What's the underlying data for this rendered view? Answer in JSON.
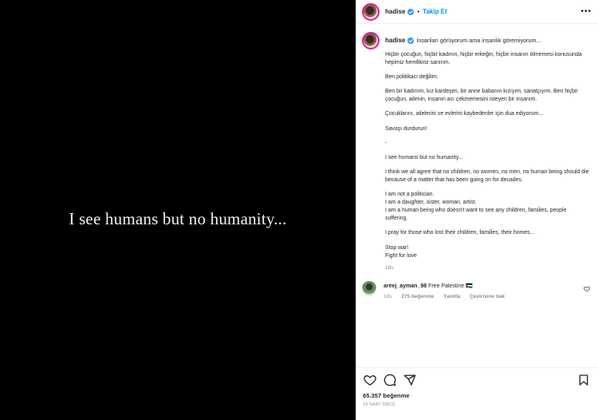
{
  "media": {
    "text": "I see humans but no humanity..."
  },
  "header": {
    "username": "hadise",
    "separator": "•",
    "follow_label": "Takip Et",
    "more_label": "•••"
  },
  "caption": {
    "username": "hadise",
    "first_line": "İnsanları görüyorum ama insanlık göremiyorum...",
    "paragraphs": [
      "Hiçbir çocuğun, hiçbir kadının, hiçbir erkeğin, hiçbir insanın ölmemesi konusunda hepimiz hemfikiriz sanırım.",
      "Ben politikacı değilim.",
      "Ben bir kadınım, kız kardeşim, bir anne babanın kızıyım, sanatçıyım. Ben hiçbir çocuğun, ailenin, insanın acı çekmemesini isteyen bir insanım.",
      "Çocuklarını, ailelerini ve evlerini kaybedenler için dua ediyorum...",
      "Savaşı durdurun!",
      "-",
      "I see humans but no humanity...",
      "I think we all agree that no children, no women, no men, no human being should die because of a matter that has been going on for decades.",
      "I am not a politician.\nI am a daughter, sister, woman, artist.\nI am a human being who doesn't want to see any children, families, people suffering.",
      "I pray for those who lost their children, families, their homes...",
      "Stop war!\nFight for love"
    ],
    "time": "18s"
  },
  "comment": {
    "username": "areej_ayman_98",
    "text": "Free Palestine 🇵🇸",
    "time": "18s",
    "likes": "275 beğenme",
    "reply": "Yanıtla",
    "translate": "Çevirisine bak"
  },
  "footer": {
    "likes": "65.357 beğenme",
    "ago": "18 SAAT ÖNCE"
  },
  "icons": [
    "heart-icon",
    "comment-icon",
    "share-icon",
    "bookmark-icon",
    "verified-icon",
    "more-icon"
  ],
  "colors": {
    "accent": "#0095f6",
    "verified": "#3897f0",
    "muted": "#8e8e8e"
  }
}
